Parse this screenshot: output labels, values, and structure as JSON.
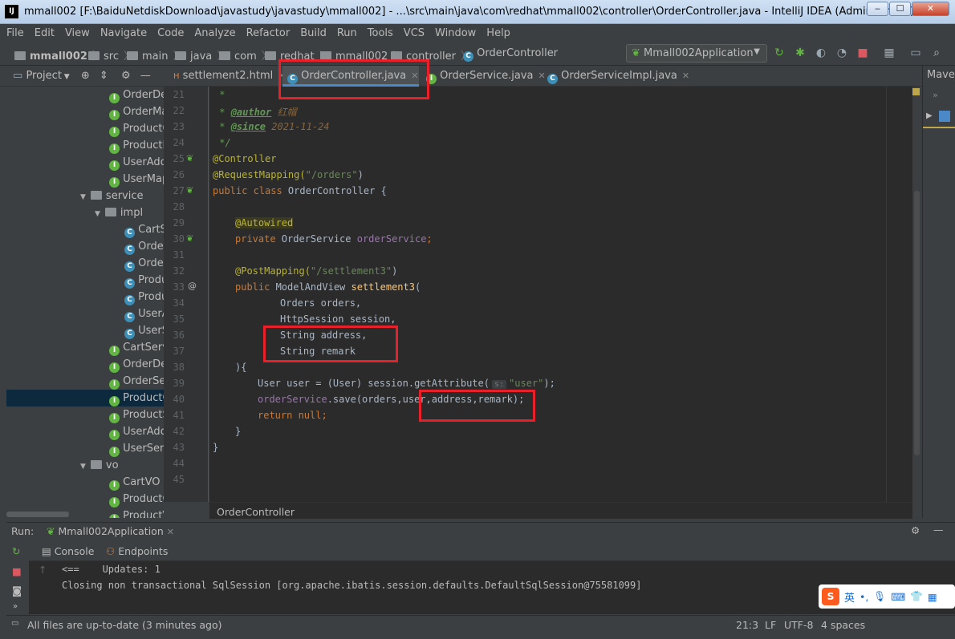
{
  "window": {
    "title": "mmall002 [F:\\BaiduNetdiskDownload\\javastudy\\javastudy\\mmall002] - ...\\src\\main\\java\\com\\redhat\\mmall002\\controller\\OrderController.java - IntelliJ IDEA (Administrator)",
    "app_icon": "IJ"
  },
  "menu": [
    "File",
    "Edit",
    "View",
    "Navigate",
    "Code",
    "Analyze",
    "Refactor",
    "Build",
    "Run",
    "Tools",
    "VCS",
    "Window",
    "Help"
  ],
  "nav": {
    "crumbs": [
      "mmall002",
      "src",
      "main",
      "java",
      "com",
      "redhat",
      "mmall002",
      "controller",
      "OrderController"
    ],
    "run_config": "Mmall002Application"
  },
  "tabs": [
    {
      "label": "settlement2.html",
      "icon": "html-icon"
    },
    {
      "label": "OrderController.java",
      "icon": "class-icon",
      "active": true
    },
    {
      "label": "OrderService.java",
      "icon": "interface-icon"
    },
    {
      "label": "OrderServiceImpl.java",
      "icon": "class-icon"
    }
  ],
  "project_panel": {
    "label": "Project",
    "tree": [
      {
        "label": "OrderDe",
        "type": "interface"
      },
      {
        "label": "OrderMa",
        "type": "interface"
      },
      {
        "label": "ProductC",
        "type": "interface"
      },
      {
        "label": "ProductM",
        "type": "interface"
      },
      {
        "label": "UserAdd",
        "type": "interface"
      },
      {
        "label": "UserMap",
        "type": "interface"
      },
      {
        "label": "service",
        "type": "folder"
      },
      {
        "label": "impl",
        "type": "folder"
      },
      {
        "label": "CartS",
        "type": "class"
      },
      {
        "label": "Orde",
        "type": "class"
      },
      {
        "label": "Orde",
        "type": "class"
      },
      {
        "label": "Produ",
        "type": "class"
      },
      {
        "label": "Produ",
        "type": "class"
      },
      {
        "label": "UserA",
        "type": "class"
      },
      {
        "label": "UserS",
        "type": "class"
      },
      {
        "label": "CartServ",
        "type": "interface"
      },
      {
        "label": "OrderDe",
        "type": "interface"
      },
      {
        "label": "OrderSe",
        "type": "interface"
      },
      {
        "label": "ProductC",
        "type": "interface",
        "selected": true
      },
      {
        "label": "ProductS",
        "type": "interface"
      },
      {
        "label": "UserAdd",
        "type": "interface"
      },
      {
        "label": "UserServ",
        "type": "interface"
      },
      {
        "label": "vo",
        "type": "folder"
      },
      {
        "label": "CartVO",
        "type": "interface"
      },
      {
        "label": "ProductC",
        "type": "interface"
      },
      {
        "label": "ProductV",
        "type": "interface"
      }
    ]
  },
  "editor": {
    "line_numbers": [
      "21",
      "22",
      "23",
      "24",
      "25",
      "26",
      "27",
      "28",
      "29",
      "30",
      "31",
      "32",
      "33",
      "34",
      "35",
      "36",
      "37",
      "38",
      "39",
      "40",
      "41",
      "42",
      "43",
      "44",
      "45"
    ],
    "lines": {
      "l21": " *",
      "l22_pre": " * ",
      "l22_tag": "@author",
      "l22_val": " 红帽",
      "l23_pre": " * ",
      "l23_tag": "@since",
      "l23_val": " 2021-11-24",
      "l24": " */",
      "l25": "@Controller",
      "l26_ann": "@RequestMapping(",
      "l26_str": "\"/orders\"",
      "l26_end": ")",
      "l27_kw": "public class ",
      "l27_name": "OrderController {",
      "l29": "@Autowired",
      "l30_kw": "private ",
      "l30_type": "OrderService ",
      "l30_field": "orderService",
      "l30_end": ";",
      "l32_ann": "@PostMapping(",
      "l32_str": "\"/settlement3\"",
      "l32_end": ")",
      "l33_kw": "public ",
      "l33_type": "ModelAndView ",
      "l33_fn": "settlement3",
      "l33_end": "(",
      "l34": "Orders orders,",
      "l35": "HttpSession session,",
      "l36": "String address,",
      "l37": "String remark",
      "l38": "){",
      "l39_pre": "User user = (User) session.getAttribute(",
      "l39_hint": "s:",
      "l39_str": "\"user\"",
      "l39_end": ");",
      "l40_field": "orderService",
      "l40_rest": ".save(orders,user,address,remark);",
      "l41": "return null;",
      "l42": "}",
      "l43": "}"
    },
    "breadcrumb": "OrderController"
  },
  "maven": {
    "label": "Mave"
  },
  "run": {
    "label": "Run:",
    "config": "Mmall002Application",
    "tabs": [
      "Console",
      "Endpoints"
    ],
    "console": [
      "<==    Updates: 1",
      "Closing non transactional SqlSession [org.apache.ibatis.session.defaults.DefaultSqlSession@75581099]"
    ]
  },
  "status": {
    "message": "All files are up-to-date (3 minutes ago)",
    "position": "21:3",
    "line_sep": "LF",
    "encoding": "UTF-8",
    "indent": "4 spaces"
  },
  "ime": {
    "logo": "S",
    "lang": "英"
  }
}
